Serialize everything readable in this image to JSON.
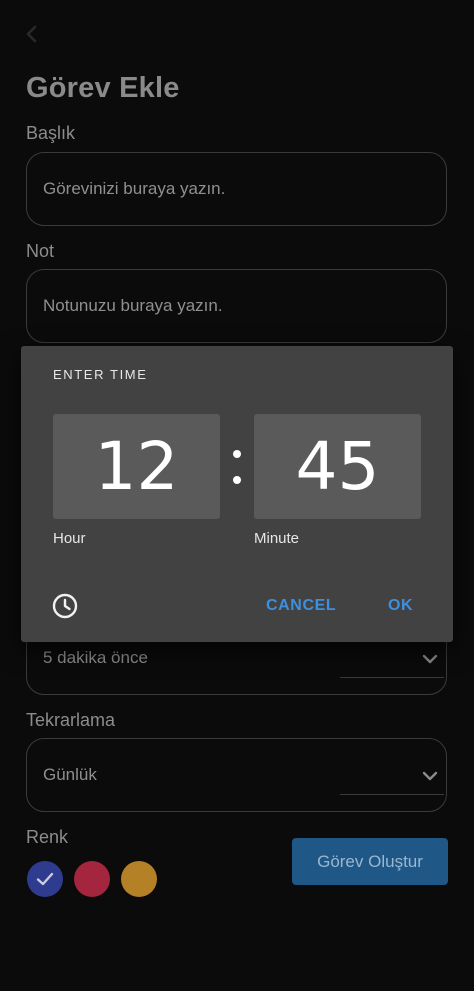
{
  "header": {
    "title": "Görev Ekle"
  },
  "form": {
    "title_label": "Başlık",
    "title_placeholder": "Görevinizi buraya yazın.",
    "note_label": "Not",
    "note_placeholder": "Notunuzu buraya yazın.",
    "reminder_value": "5 dakika önce",
    "repeat_label": "Tekrarlama",
    "repeat_value": "Günlük",
    "color_label": "Renk",
    "colors": [
      "#2f3b8f",
      "#a3263e",
      "#b58127"
    ],
    "selected_color_index": 0,
    "submit_label": "Görev Oluştur"
  },
  "time_dialog": {
    "title": "ENTER TIME",
    "hour": "12",
    "minute": "45",
    "hour_caption": "Hour",
    "minute_caption": "Minute",
    "cancel_label": "CANCEL",
    "ok_label": "OK",
    "accent_color": "#3d8fe0"
  }
}
